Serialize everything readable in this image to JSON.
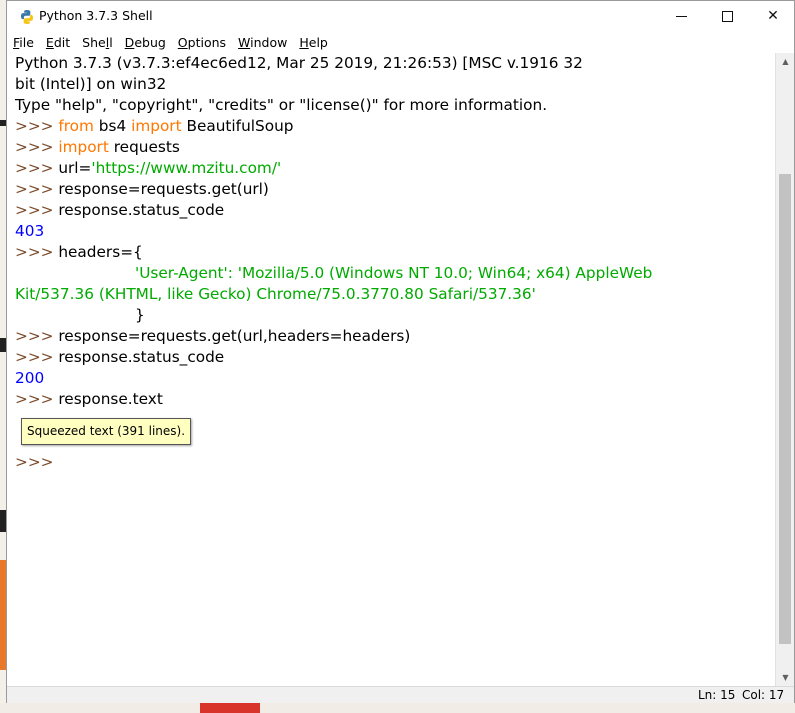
{
  "window": {
    "title": "Python 3.7.3 Shell",
    "minimize_icon": "minimize-icon",
    "maximize_icon": "maximize-icon",
    "close_icon": "close-icon",
    "close_glyph": "✕"
  },
  "menu": [
    {
      "u": "F",
      "rest": "ile"
    },
    {
      "u": "E",
      "rest": "dit"
    },
    {
      "u": "",
      "pre": "She",
      "u2": "l",
      "rest": "l"
    },
    {
      "u": "D",
      "rest": "ebug"
    },
    {
      "u": "O",
      "rest": "ptions"
    },
    {
      "u": "W",
      "rest": "indow"
    },
    {
      "u": "H",
      "rest": "elp"
    }
  ],
  "shell": {
    "prompt": ">>> ",
    "banner1": "Python 3.7.3 (v3.7.3:ef4ec6ed12, Mar 25 2019, 21:26:53) [MSC v.1916 32",
    "banner2": "bit (Intel)] on win32",
    "banner3": "Type \"help\", \"copyright\", \"credits\" or \"license()\" for more information.",
    "l1_kw1": "from",
    "l1_mid": " bs4 ",
    "l1_kw2": "import",
    "l1_end": " BeautifulSoup",
    "l2_kw": "import",
    "l2_end": " requests",
    "l3_pre": "url=",
    "l3_str": "'https://www.mzitu.com/'",
    "l4": "response=requests.get(url)",
    "l5": "response.status_code",
    "out1": "403",
    "l6": "headers={",
    "h1_str": "'User-Agent': 'Mozilla/5.0 (Windows NT 10.0; Win64; x64) AppleWeb",
    "h2_str": "Kit/537.36 (KHTML, like Gecko) Chrome/75.0.3770.80 Safari/537.36'",
    "h3": "}",
    "l7": "response=requests.get(url,headers=headers)",
    "l8": "response.status_code",
    "out2": "200",
    "l9": "response.text",
    "squeezed": "Squeezed text (391 lines).",
    "last_prompt": ">>>"
  },
  "status": {
    "ln": "Ln: 15",
    "col": "Col: 17"
  },
  "colors": {
    "keyword": "#ff7700",
    "string": "#00aa00",
    "output": "#0000ff",
    "prompt": "#7a4a2a"
  }
}
